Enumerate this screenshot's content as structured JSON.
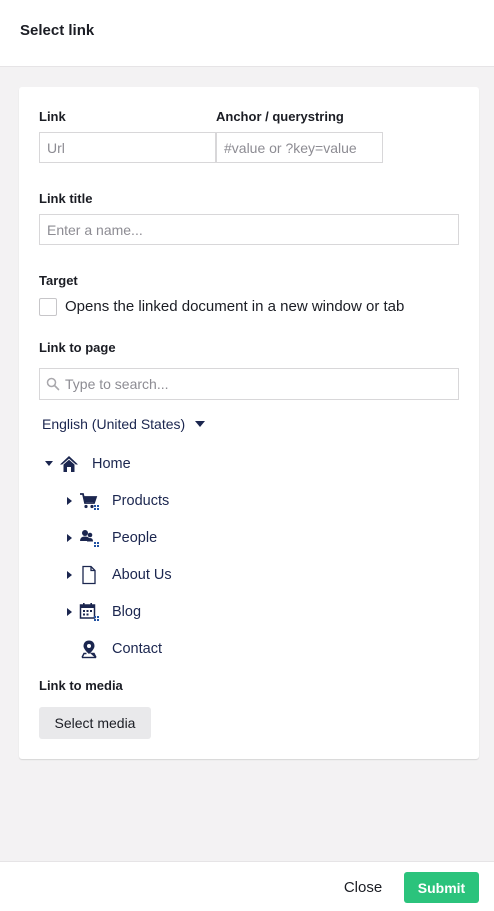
{
  "dialog": {
    "title": "Select link"
  },
  "link": {
    "label": "Link",
    "placeholder": "Url"
  },
  "anchor": {
    "label": "Anchor / querystring",
    "placeholder": "#value or ?key=value"
  },
  "link_title": {
    "label": "Link title",
    "placeholder": "Enter a name..."
  },
  "target": {
    "label": "Target",
    "checkbox_label": "Opens the linked document in a new window or tab",
    "checked": false
  },
  "link_to_page": {
    "label": "Link to page",
    "search_placeholder": "Type to search...",
    "culture": "English (United States)",
    "tree": [
      {
        "label": "Home",
        "icon": "home-icon",
        "expanded": true
      },
      {
        "label": "Products",
        "icon": "shopping-cart-icon",
        "expanded": false
      },
      {
        "label": "People",
        "icon": "people-icon",
        "expanded": false
      },
      {
        "label": "About Us",
        "icon": "document-icon",
        "expanded": false
      },
      {
        "label": "Blog",
        "icon": "calendar-icon",
        "expanded": false
      },
      {
        "label": "Contact",
        "icon": "map-pin-icon",
        "expanded": false
      }
    ]
  },
  "link_to_media": {
    "label": "Link to media",
    "button": "Select media"
  },
  "footer": {
    "close": "Close",
    "submit": "Submit"
  },
  "colors": {
    "submit": "#2bc37c",
    "text": "#1b264f",
    "accent_icon": "#2152a3"
  }
}
